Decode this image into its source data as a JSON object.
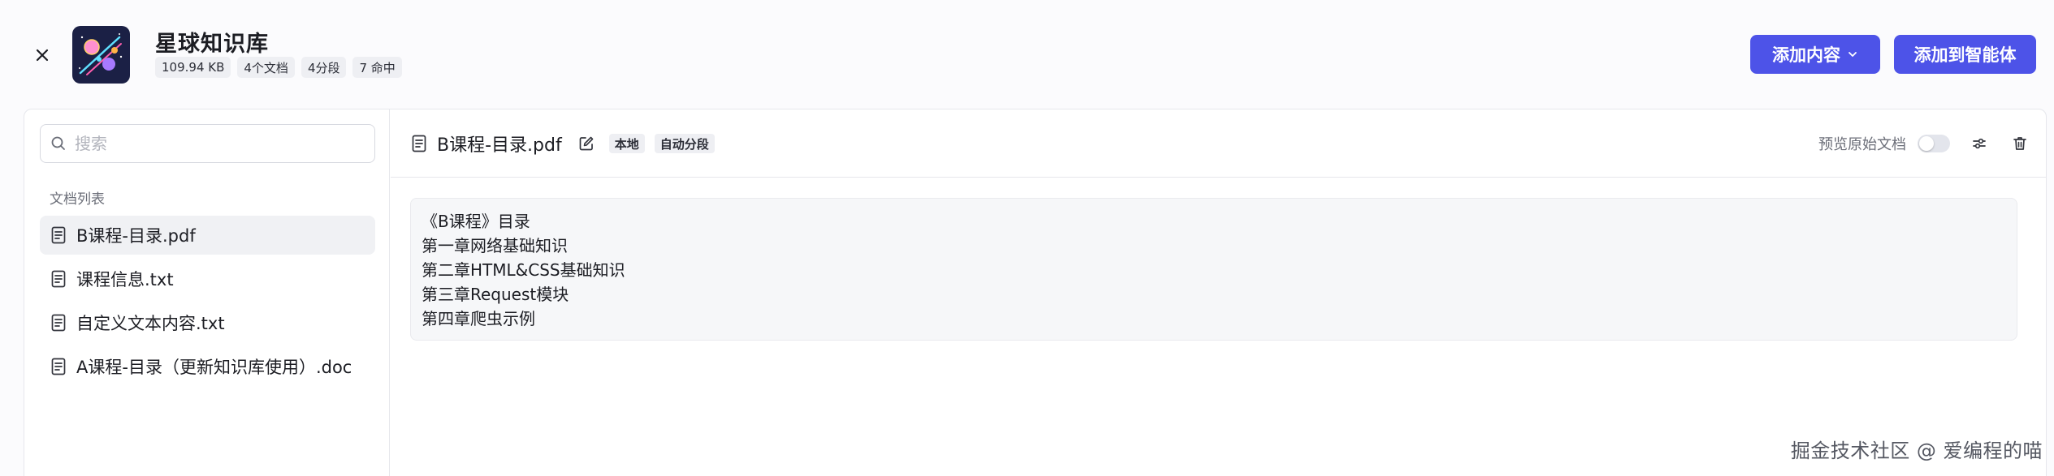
{
  "header": {
    "close_icon": "close-icon",
    "logo_icon": "planet-logo-icon",
    "title": "星球知识库",
    "badges": [
      "109.94 KB",
      "4个文档",
      "4分段",
      "7 命中"
    ],
    "add_content_label": "添加内容",
    "add_to_agent_label": "添加到智能体",
    "accent_color": "#4d53e8"
  },
  "sidebar": {
    "search": {
      "placeholder": "搜索",
      "value": ""
    },
    "list_heading": "文档列表",
    "documents": [
      {
        "name": "B课程-目录.pdf",
        "selected": true
      },
      {
        "name": "课程信息.txt",
        "selected": false
      },
      {
        "name": "自定义文本内容.txt",
        "selected": false
      },
      {
        "name": "A课程-目录（更新知识库使用）.doc",
        "selected": false
      }
    ]
  },
  "main": {
    "doc_title": "B课程-目录.pdf",
    "tags": [
      "本地",
      "自动分段"
    ],
    "preview_label": "预览原始文档",
    "preview_enabled": false,
    "content_lines": [
      "《B课程》目录",
      "第一章网络基础知识",
      "第二章HTML&CSS基础知识",
      "第三章Request模块",
      "第四章爬虫示例"
    ]
  },
  "watermark": "掘金技术社区 @ 爱编程的喵"
}
